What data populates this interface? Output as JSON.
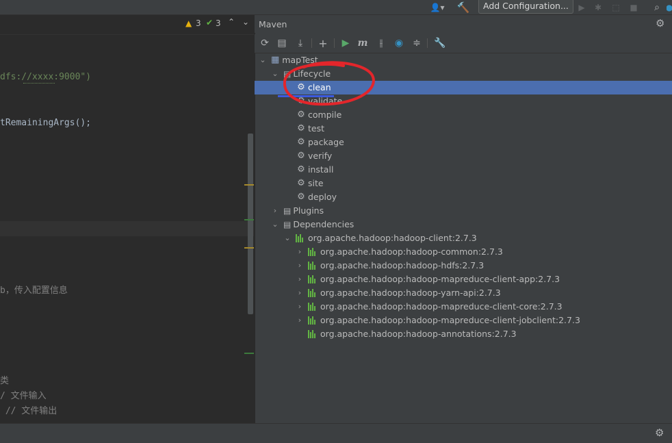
{
  "toolbar": {
    "run_config_label": "Add Configuration..."
  },
  "editor": {
    "warnings_count": "3",
    "checks_count": "3",
    "lines": [
      {
        "text": "dfs://xxxx:9000\")",
        "kind": "str"
      },
      {
        "text": "tRemainingArgs();",
        "kind": "code"
      },
      {
        "text": "b，传入配置信息",
        "kind": "cm"
      },
      {
        "text": "类",
        "kind": "cm"
      },
      {
        "text": "/ 文件输入",
        "kind": "cm"
      },
      {
        "text": " // 文件输出",
        "kind": "cm"
      }
    ]
  },
  "maven": {
    "title": "Maven",
    "root": "mapTest",
    "lifecycle_label": "Lifecycle",
    "lifecycle": [
      "clean",
      "validate",
      "compile",
      "test",
      "package",
      "verify",
      "install",
      "site",
      "deploy"
    ],
    "selected": "clean",
    "plugins_label": "Plugins",
    "dependencies_label": "Dependencies",
    "root_dependency": "org.apache.hadoop:hadoop-client:2.7.3",
    "child_dependencies": [
      {
        "label": "org.apache.hadoop:hadoop-common:2.7.3",
        "expandable": true
      },
      {
        "label": "org.apache.hadoop:hadoop-hdfs:2.7.3",
        "expandable": true
      },
      {
        "label": "org.apache.hadoop:hadoop-mapreduce-client-app:2.7.3",
        "expandable": true
      },
      {
        "label": "org.apache.hadoop:hadoop-yarn-api:2.7.3",
        "expandable": true
      },
      {
        "label": "org.apache.hadoop:hadoop-mapreduce-client-core:2.7.3",
        "expandable": true
      },
      {
        "label": "org.apache.hadoop:hadoop-mapreduce-client-jobclient:2.7.3",
        "expandable": true
      },
      {
        "label": "org.apache.hadoop:hadoop-annotations:2.7.3",
        "expandable": false
      }
    ]
  },
  "colors": {
    "selection": "#4b6eaf",
    "annotation": "#e3262b",
    "run_green": "#59a869",
    "dependency_green": "#62b543"
  }
}
